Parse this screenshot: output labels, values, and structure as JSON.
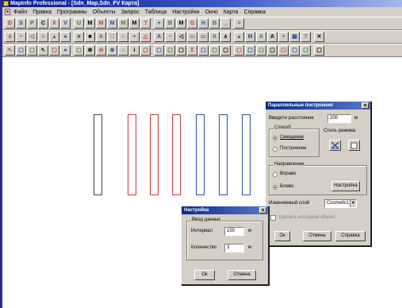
{
  "window": {
    "title": "MapInfo Professional - [Sdn_Map,Sdn_FV Карта]"
  },
  "menu": [
    "Файл",
    "Правка",
    "Программы",
    "Объекты",
    "Запрос",
    "Таблица",
    "Настройки",
    "Окно",
    "Карта",
    "Справка"
  ],
  "toolbars": {
    "row1": [
      "D",
      "S",
      "P",
      "C",
      "X",
      "V",
      "U",
      "M",
      "M",
      "M",
      "M",
      "M",
      "?",
      "+",
      "B",
      "M",
      "G",
      "H",
      "B",
      "_",
      "="
    ],
    "row2": [
      "∧",
      "~",
      "◁",
      "○",
      "▲",
      "●",
      "■",
      "■",
      "A",
      "□",
      "∩",
      "~",
      "△",
      "A",
      "~",
      "◁",
      "▭",
      "▭",
      "A",
      "∧",
      "▲",
      "M",
      "A",
      "A",
      "+",
      "▦",
      "?",
      "✕"
    ],
    "row3": [
      "↖",
      "▢",
      "▢",
      "↖",
      "▢",
      "●",
      "▢",
      "⊕",
      "⊖",
      "⊕",
      "○",
      "i",
      "▢",
      "▢",
      "▢",
      "▢",
      "Σ",
      "▢",
      "▢",
      "▢",
      "▢",
      "▢",
      "▢",
      "▢",
      "▢",
      "▢",
      "▢",
      "▢"
    ]
  },
  "colors": {
    "red": "#c83a3a",
    "blue": "#2a4fa8",
    "black": "#444444"
  },
  "rectangles": [
    {
      "color": "black"
    },
    {
      "color": "red"
    },
    {
      "color": "red"
    },
    {
      "color": "red"
    },
    {
      "color": "blue"
    },
    {
      "color": "blue"
    },
    {
      "color": "blue"
    },
    {
      "color": "blue"
    }
  ],
  "parallel_dialog": {
    "title": "Параллельные построения",
    "distance_label": "Введите расстояние",
    "distance_value": "200",
    "distance_unit": "м",
    "method": {
      "title": "Способ",
      "option1": "Смещение",
      "option2": "Построение",
      "selected": "Смещение"
    },
    "line_style": {
      "label": "Стиль режима"
    },
    "direction": {
      "title": "Направление",
      "option1": "Вправо",
      "option2": "Влево",
      "selected": "Влево",
      "settings_button": "Настройка"
    },
    "layer_label": "Изменяемый слой",
    "layer_value": "Cosmetic1",
    "delete_source": "Удалить исходный объект",
    "ok": "Ок",
    "cancel": "Отмена",
    "help": "Справка"
  },
  "settings_dialog": {
    "title": "Настройка",
    "group_title": "Ввод данных",
    "interval_label": "Интервал",
    "interval_value": "150",
    "interval_unit": "м",
    "count_label": "Количество",
    "count_value": "3",
    "count_unit": "м",
    "ok": "Ок",
    "cancel": "Отмена"
  }
}
